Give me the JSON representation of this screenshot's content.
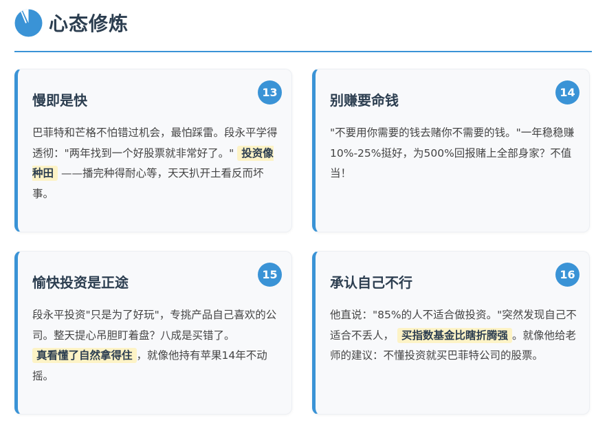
{
  "header": {
    "title": "心态修炼",
    "icon": "pie-chart-icon",
    "accent_color": "#3a93d6"
  },
  "cards": [
    {
      "number": "13",
      "title": "慢即是快",
      "text_before": "巴菲特和芒格不怕错过机会，最怕踩雷。段永平学得透彻：\"两年找到一个好股票就非常好了。\"",
      "highlight": "投资像种田",
      "text_after": "——播完种得耐心等，天天扒开土看反而坏事。"
    },
    {
      "number": "14",
      "title": "别赚要命钱",
      "text_before": "\"不要用你需要的钱去赌你不需要的钱。\"一年稳稳赚10%-25%挺好，为500%回报赌上全部身家？不值当！",
      "highlight": "",
      "text_after": ""
    },
    {
      "number": "15",
      "title": "愉快投资是正途",
      "text_before": "段永平投资\"只是为了好玩\"，专挑产品自己喜欢的公司。整天提心吊胆盯着盘？八成是买错了。",
      "highlight": "真看懂了自然拿得住",
      "text_after": "，就像他持有苹果14年不动摇。"
    },
    {
      "number": "16",
      "title": "承认自己不行",
      "text_before": "他直说：\"85%的人不适合做投资。\"突然发现自己不适合不丢人，",
      "highlight": "买指数基金比瞎折腾强",
      "text_after": "。就像他给老师的建议：不懂投资就买巴菲特公司的股票。"
    }
  ]
}
